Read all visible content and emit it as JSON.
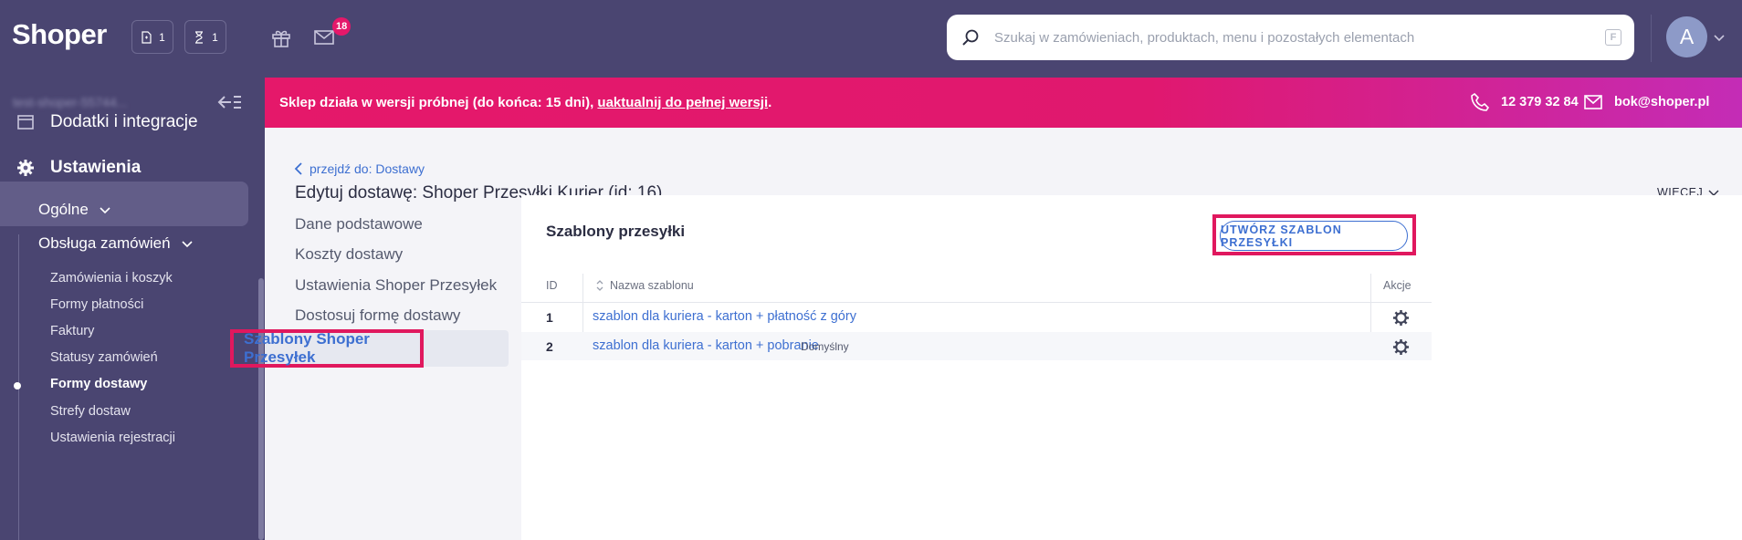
{
  "app": {
    "logo": "Shoper"
  },
  "topbar": {
    "counters": [
      {
        "icon": "document-icon",
        "count": "1"
      },
      {
        "icon": "hourglass-icon",
        "count": "1"
      }
    ],
    "mail_badge": "18",
    "search": {
      "placeholder": "Szukaj w zamówieniach, produktach, menu i pozostałych elementach",
      "shortcut": "F"
    },
    "avatar_letter": "A"
  },
  "sidebar": {
    "shop_name": "test-shoper-55744...",
    "main_items": [
      {
        "label": "Dodatki i integracje",
        "icon": "window-icon"
      },
      {
        "label": "Ustawienia",
        "icon": "gear-icon"
      }
    ],
    "sub_items": [
      {
        "label": "Ogólne"
      },
      {
        "label": "Obsługa zamówień"
      }
    ],
    "leaf_items": [
      {
        "label": "Zamówienia i koszyk"
      },
      {
        "label": "Formy płatności"
      },
      {
        "label": "Faktury"
      },
      {
        "label": "Statusy zamówień"
      },
      {
        "label": "Formy dostawy"
      },
      {
        "label": "Strefy dostaw"
      },
      {
        "label": "Ustawienia rejestracji"
      }
    ]
  },
  "banner": {
    "text": "Sklep działa w wersji próbnej (do końca: 15 dni), ",
    "link": "uaktualnij do pełnej wersji",
    "end": ".",
    "phone": "12 379 32 84",
    "email": "bok@shoper.pl"
  },
  "page": {
    "back_link": "przejdź do: Dostawy",
    "title": "Edytuj dostawę: Shoper Przesyłki Kurier (id: 16)",
    "more": "WIĘCEJ"
  },
  "subnav": [
    {
      "label": "Dane podstawowe"
    },
    {
      "label": "Koszty dostawy"
    },
    {
      "label": "Ustawienia Shoper Przesyłek"
    },
    {
      "label": "Dostosuj formę dostawy"
    },
    {
      "label": "Szablony Shoper Przesyłek"
    }
  ],
  "card": {
    "title": "Szablony przesyłki",
    "create_button": "UTWÓRZ SZABLON PRZESYŁKI",
    "columns": {
      "id": "ID",
      "name": "Nazwa szablonu",
      "actions": "Akcje"
    },
    "rows": [
      {
        "id": "1",
        "name": "szablon dla kuriera - karton + płatność z góry",
        "tag": ""
      },
      {
        "id": "2",
        "name": "szablon dla kuriera - karton + pobranie",
        "tag": "Domyślny"
      }
    ]
  },
  "colors": {
    "topbar": "#4a4571",
    "accent_pink": "#e5186a",
    "link_blue": "#3d6fd1"
  }
}
